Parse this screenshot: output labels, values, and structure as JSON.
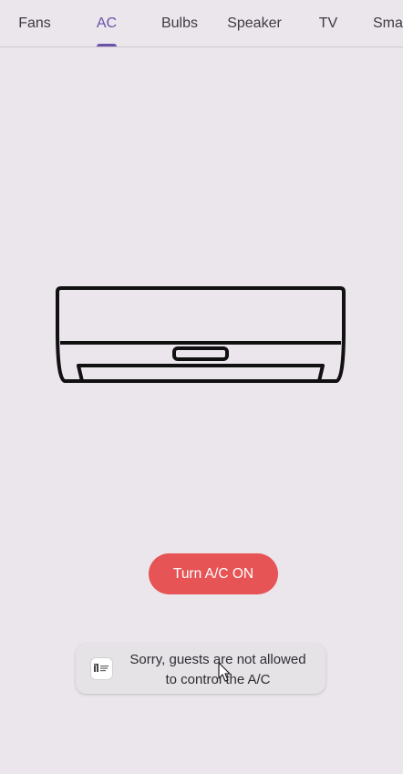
{
  "tabs": [
    {
      "label": "Fans"
    },
    {
      "label": "AC"
    },
    {
      "label": "Bulbs"
    },
    {
      "label": "Speaker"
    },
    {
      "label": "TV"
    },
    {
      "label": "Sma"
    }
  ],
  "active_tab": "AC",
  "ac_illustration_icon": "air-conditioner-icon",
  "turn_on_button_label": "Turn A/C ON",
  "toast": {
    "line1": "Sorry, guests are not allowed",
    "line2": "to control the A/C",
    "icon": "app-logo-icon"
  },
  "colors": {
    "background": "#ebe6ec",
    "accent": "#6a52a8",
    "button": "#e65455",
    "toast_background": "#e6e3e6"
  }
}
